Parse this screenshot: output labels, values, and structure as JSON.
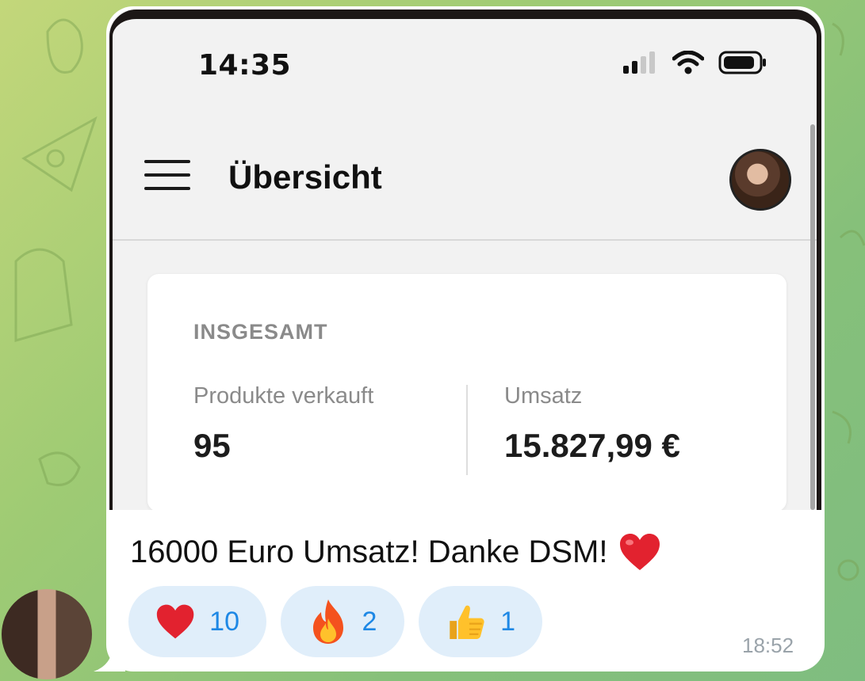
{
  "phone": {
    "status_time": "14:35",
    "header_title": "Übersicht",
    "card": {
      "heading": "INSGESAMT",
      "stats": [
        {
          "label": "Produkte verkauft",
          "value": "95"
        },
        {
          "label": "Umsatz",
          "value": "15.827,99 €"
        }
      ]
    }
  },
  "message": {
    "text": "16000 Euro Umsatz! Danke DSM!",
    "text_emoji": "heart-emoji",
    "time": "18:52",
    "reactions": [
      {
        "icon": "heart-icon",
        "count": "10"
      },
      {
        "icon": "fire-icon",
        "count": "2"
      },
      {
        "icon": "thumbs-up-icon",
        "count": "1"
      }
    ]
  },
  "colors": {
    "reaction_bg": "#e0eefa",
    "reaction_count": "#1e88e5",
    "heart": "#e2222f"
  }
}
